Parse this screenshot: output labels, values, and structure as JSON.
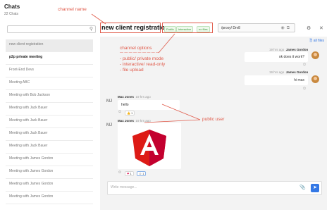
{
  "sidebar": {
    "title": "Chats",
    "count": "22 Chats",
    "items": [
      {
        "label": "new client registration"
      },
      {
        "label": "p2p private meeting"
      },
      {
        "label": "Front-End Devs"
      },
      {
        "label": "Meeting ABC"
      },
      {
        "label": "Meeting with Bob Jackson"
      },
      {
        "label": "Meeting with Jack Bauer"
      },
      {
        "label": "Meeting with Jack Bauer"
      },
      {
        "label": "Meeting with Jack Bauer"
      },
      {
        "label": "Meeting with Jack Bauer"
      },
      {
        "label": "Meeting with James Gordon"
      },
      {
        "label": "Meeting with James Gordon"
      },
      {
        "label": "Meeting with James Gordon"
      },
      {
        "label": "Meeting with James Gordon"
      }
    ]
  },
  "header": {
    "channel_name": "new client registration",
    "badges": [
      "Public",
      "interactive",
      "no files"
    ],
    "share_text": "/proxy/ Drv8"
  },
  "main": {
    "all_files": "all files",
    "messages": [
      {
        "author": "James Gordon",
        "time": "19 hrs ago",
        "text": "ok does it work?"
      },
      {
        "author": "James Gordon",
        "time": "19 hrs ago",
        "text": "hi max"
      },
      {
        "initials": "MJ",
        "author": "Max Jones",
        "time": "19 hrs ago",
        "text": "hello",
        "reaction": "1"
      },
      {
        "initials": "MJ",
        "author": "Max Jones",
        "time": "19 hrs ago",
        "reactions": [
          "1",
          "1"
        ]
      }
    ],
    "composer_placeholder": "Write message..."
  },
  "annotations": {
    "channel_name": "channel name",
    "channel_options": "channel options",
    "dashes": "— — — — — — — — —",
    "public_private": "- public/ private mode",
    "interactive": "- interactive/ read-only",
    "file_upload": "- file upload",
    "public_user": "public user"
  },
  "colors": {
    "annotation": "#e05a4a",
    "accent": "#3478e5",
    "angular_red": "#dd1b16",
    "angular_dark": "#c3002f"
  }
}
